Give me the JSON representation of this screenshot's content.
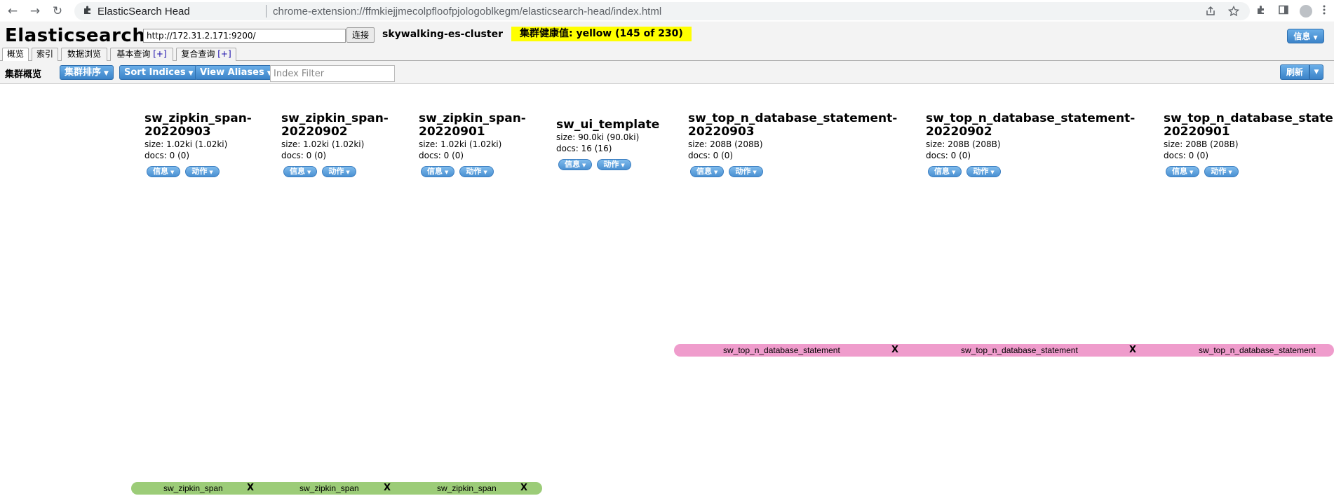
{
  "browser": {
    "back_icon": "←",
    "forward_icon": "→",
    "reload_icon": "↻",
    "site_name": "ElasticSearch Head",
    "url": "chrome-extension://ffmkiejjmecolpfloofpjologoblkegm/elasticsearch-head/index.html"
  },
  "header": {
    "title": "Elasticsearch",
    "connect_url": "http://172.31.2.171:9200/",
    "connect_label": "连接",
    "cluster_name": "skywalking-es-cluster",
    "health_label": "集群健康值: yellow (145 of 230)",
    "health_color": "#ffff00",
    "info_label": "信息"
  },
  "tabs": [
    {
      "label": "概览",
      "plus": ""
    },
    {
      "label": "索引",
      "plus": ""
    },
    {
      "label": "数据浏览",
      "plus": ""
    },
    {
      "label": "基本查询",
      "plus": "[+]"
    },
    {
      "label": "复合查询",
      "plus": "[+]"
    }
  ],
  "toolbar": {
    "title": "集群概览",
    "cluster_sort": "集群排序",
    "sort_indices": "Sort Indices",
    "view_aliases": "View Aliases",
    "filter_placeholder": "Index Filter",
    "refresh": "刷新"
  },
  "indices": [
    {
      "name_1": "sw_zipkin_span-",
      "name_2": "20220903",
      "size": "size: 1.02ki (1.02ki)",
      "docs": "docs: 0 (0)",
      "info": "信息",
      "action": "动作"
    },
    {
      "name_1": "sw_zipkin_span-",
      "name_2": "20220902",
      "size": "size: 1.02ki (1.02ki)",
      "docs": "docs: 0 (0)",
      "info": "信息",
      "action": "动作"
    },
    {
      "name_1": "sw_zipkin_span-",
      "name_2": "20220901",
      "size": "size: 1.02ki (1.02ki)",
      "docs": "docs: 0 (0)",
      "info": "信息",
      "action": "动作"
    },
    {
      "name_1": "sw_ui_template",
      "name_2": "",
      "size": "size: 90.0ki (90.0ki)",
      "docs": "docs: 16 (16)",
      "info": "信息",
      "action": "动作"
    },
    {
      "name_1": "sw_top_n_database_statement-",
      "name_2": "20220903",
      "size": "size: 208B (208B)",
      "docs": "docs: 0 (0)",
      "info": "信息",
      "action": "动作"
    },
    {
      "name_1": "sw_top_n_database_statement-",
      "name_2": "20220902",
      "size": "size: 208B (208B)",
      "docs": "docs: 0 (0)",
      "info": "信息",
      "action": "动作"
    },
    {
      "name_1": "sw_top_n_database_state",
      "name_2": "20220901",
      "size": "size: 208B (208B)",
      "docs": "docs: 0 (0)",
      "info": "信息",
      "action": "动作"
    }
  ],
  "aliases": {
    "pink": [
      {
        "label": "sw_top_n_database_statement",
        "x": "X"
      },
      {
        "label": "sw_top_n_database_statement",
        "x": "X"
      },
      {
        "label": "sw_top_n_database_statement",
        "x": ""
      }
    ],
    "green": [
      {
        "label": "sw_zipkin_span",
        "x": "X"
      },
      {
        "label": "sw_zipkin_span",
        "x": "X"
      },
      {
        "label": "sw_zipkin_span",
        "x": "X"
      }
    ],
    "pink_color": "#ef9ccc",
    "green_color": "#9ccc78"
  }
}
